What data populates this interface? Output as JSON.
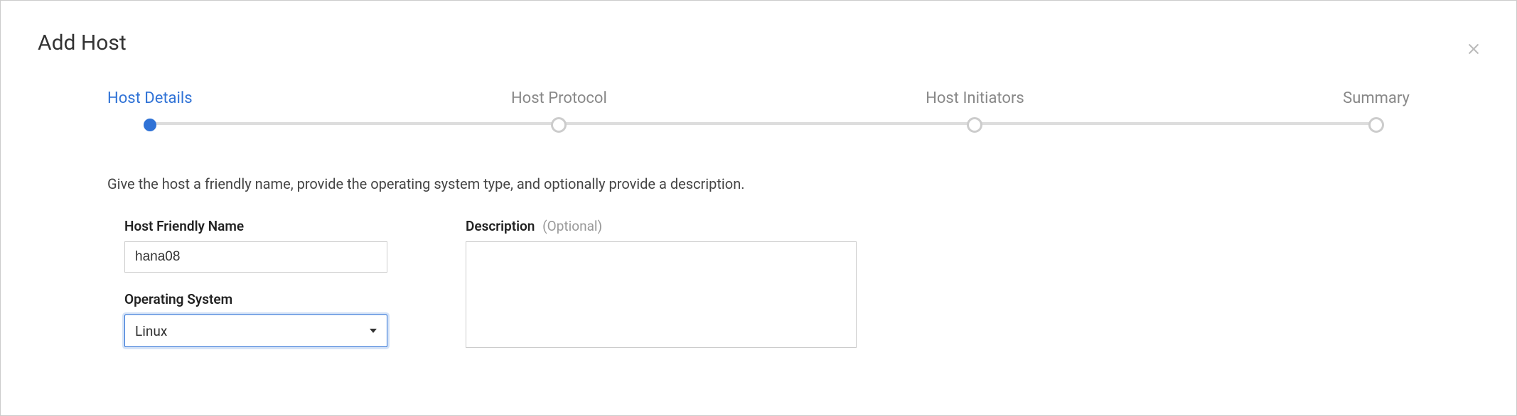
{
  "modal": {
    "title": "Add Host"
  },
  "stepper": {
    "steps": [
      {
        "label": "Host Details",
        "active": true
      },
      {
        "label": "Host Protocol",
        "active": false
      },
      {
        "label": "Host Initiators",
        "active": false
      },
      {
        "label": "Summary",
        "active": false
      }
    ]
  },
  "instruction": "Give the host a friendly name, provide the operating system type, and optionally provide a description.",
  "form": {
    "hostFriendlyName": {
      "label": "Host Friendly Name",
      "value": "hana08"
    },
    "operatingSystem": {
      "label": "Operating System",
      "value": "Linux"
    },
    "description": {
      "label": "Description",
      "optional": "(Optional)",
      "value": ""
    }
  }
}
